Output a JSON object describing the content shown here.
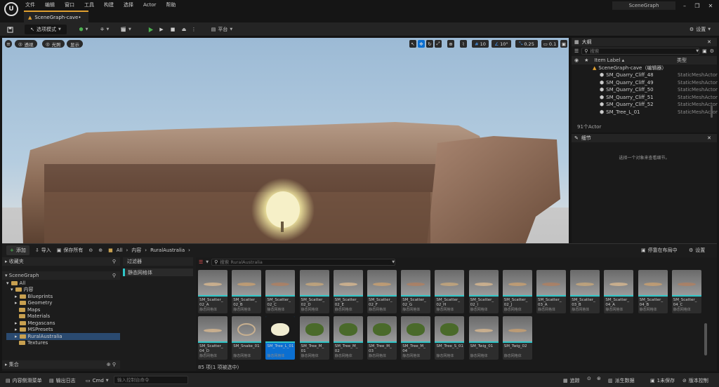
{
  "window": {
    "logo": "U",
    "doc_tab": "SceneGraph-cave•",
    "app_tab": "SceneGraph",
    "menu": [
      "文件",
      "编辑",
      "窗口",
      "工具",
      "构建",
      "选择",
      "Actor",
      "帮助"
    ]
  },
  "toolbar": {
    "mode": "选项模式",
    "platform": "平台",
    "settings": "设置"
  },
  "viewport": {
    "perspective": "透视",
    "lit": "光照",
    "show": "显示",
    "grid_snap": "10",
    "rot_snap": "10°",
    "scale_snap": "0.25",
    "cam_speed": "0.1"
  },
  "outliner": {
    "title": "大纲",
    "search_placeholder": "搜索",
    "col_label": "Item Label ▴",
    "col_type": "类型",
    "root": "SceneGraph-cave（编辑器）",
    "rows": [
      {
        "label": "SM_Quarry_Cliff_48",
        "type": "StaticMeshActor"
      },
      {
        "label": "SM_Quarry_Cliff_49",
        "type": "StaticMeshActor"
      },
      {
        "label": "SM_Quarry_Cliff_50",
        "type": "StaticMeshActor"
      },
      {
        "label": "SM_Quarry_Cliff_51",
        "type": "StaticMeshActor"
      },
      {
        "label": "SM_Quarry_Cliff_52",
        "type": "StaticMeshActor"
      },
      {
        "label": "SM_Tree_L_01",
        "type": "StaticMeshActor"
      }
    ],
    "count": "91个Actor"
  },
  "details": {
    "title": "细节",
    "hint": "选择一个对象来查看细节。"
  },
  "content_browser": {
    "add": "添加",
    "import": "导入",
    "save_all": "保存所有",
    "path": [
      "All",
      "内容",
      "RuralAustralia"
    ],
    "dock": "停靠在布局中",
    "settings": "设置",
    "favorites": "收藏夹",
    "project": "SceneGraph",
    "collections": "集合",
    "filters_title": "过滤器",
    "filter_chip": "静态网格体",
    "search_placeholder": "搜索 RuralAustralia",
    "status": "85 项(1 项被选中)",
    "tree": [
      {
        "label": "All",
        "indent": 0
      },
      {
        "label": "内容",
        "indent": 1
      },
      {
        "label": "Blueprints",
        "indent": 2
      },
      {
        "label": "Geometry",
        "indent": 2
      },
      {
        "label": "Maps",
        "indent": 2
      },
      {
        "label": "Materials",
        "indent": 2
      },
      {
        "label": "Megascans",
        "indent": 2
      },
      {
        "label": "MSPresets",
        "indent": 2
      },
      {
        "label": "RuralAustralia",
        "indent": 2
      },
      {
        "label": "Textures",
        "indent": 2
      }
    ],
    "asset_type": "静态网格体",
    "row1": [
      {
        "name": "SM_Scatter_02_A",
        "n1": "SM_Scatter_",
        "n2": "02_A"
      },
      {
        "name": "SM_Scatter_02_B",
        "n1": "SM_Scatter_",
        "n2": "02_B"
      },
      {
        "name": "SM_Scatter_02_C",
        "n1": "SM_Scatter_",
        "n2": "02_C"
      },
      {
        "name": "SM_Scatter_02_D",
        "n1": "SM_Scatter_",
        "n2": "02_D"
      },
      {
        "name": "SM_Scatter_02_E",
        "n1": "SM_Scatter_",
        "n2": "02_E"
      },
      {
        "name": "SM_Scatter_02_F",
        "n1": "SM_Scatter_",
        "n2": "02_F"
      },
      {
        "name": "SM_Scatter_02_G",
        "n1": "SM_Scatter_",
        "n2": "02_G"
      },
      {
        "name": "SM_Scatter_02_H",
        "n1": "SM_Scatter_",
        "n2": "02_H"
      },
      {
        "name": "SM_Scatter_02_I",
        "n1": "SM_Scatter_",
        "n2": "02_I"
      },
      {
        "name": "SM_Scatter_02_J",
        "n1": "SM_Scatter_",
        "n2": "02_J"
      },
      {
        "name": "SM_Scatter_03_A",
        "n1": "SM_Scatter_",
        "n2": "03_A"
      },
      {
        "name": "SM_Scatter_03_B",
        "n1": "SM_Scatter_",
        "n2": "03_B"
      },
      {
        "name": "SM_Scatter_04_A",
        "n1": "SM_Scatter_",
        "n2": "04_A"
      },
      {
        "name": "SM_Scatter_04_B",
        "n1": "SM_Scatter_",
        "n2": "04_B"
      },
      {
        "name": "SM_Scatter_04_C",
        "n1": "SM_Scatter_",
        "n2": "04_C"
      }
    ],
    "row2": [
      {
        "name": "SM_Scatter_04_D",
        "n1": "SM_Scatter_",
        "n2": "04_D"
      },
      {
        "name": "SM_Snake_01",
        "n1": "SM_Snake_01",
        "n2": ""
      },
      {
        "name": "SM_Tree_L_01",
        "n1": "SM_Tree_L_01",
        "n2": ""
      },
      {
        "name": "SM_Tree_M_01",
        "n1": "SM_Tree_M_",
        "n2": "01"
      },
      {
        "name": "SM_Tree_M_02",
        "n1": "SM_Tree_M_",
        "n2": "02"
      },
      {
        "name": "SM_Tree_M_03",
        "n1": "SM_Tree_M_",
        "n2": "03"
      },
      {
        "name": "SM_Tree_M_04",
        "n1": "SM_Tree_M_",
        "n2": "04"
      },
      {
        "name": "SM_Tree_S_01",
        "n1": "SM_Tree_S_01",
        "n2": ""
      },
      {
        "name": "SM_Twig_01",
        "n1": "SM_Twig_01",
        "n2": ""
      },
      {
        "name": "SM_Twig_02",
        "n1": "SM_Twig_02",
        "n2": ""
      }
    ]
  },
  "statusbar": {
    "drawer": "内容侧滑菜单",
    "log": "输出日志",
    "cmd": "Cmd",
    "console_placeholder": "输入控制台命令",
    "trace": "追踪",
    "derived": "派生数据",
    "unsaved": "1未保存",
    "source": "版本控制"
  },
  "colors": {
    "accent": "#e0a030",
    "selection": "#0b6fd1",
    "static_mesh": "#2fc7c9",
    "play": "#4caf50"
  }
}
